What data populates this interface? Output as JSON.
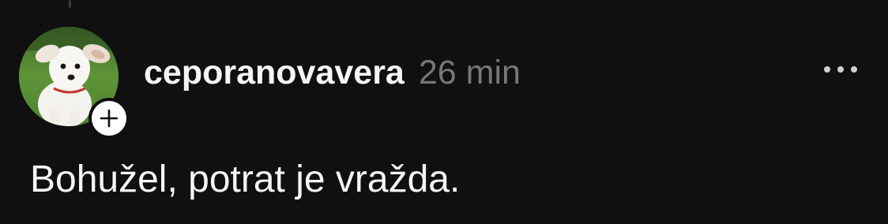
{
  "post": {
    "username": "ceporanovavera",
    "time": "26 min",
    "text": "Bohužel, potrat je vražda.",
    "avatar_icon": "dog-photo-avatar",
    "follow_icon": "plus-icon",
    "more_icon": "more-dots-icon"
  },
  "colors": {
    "background": "#101010",
    "primary_text": "#f3f5f7",
    "secondary_text": "#777777"
  }
}
